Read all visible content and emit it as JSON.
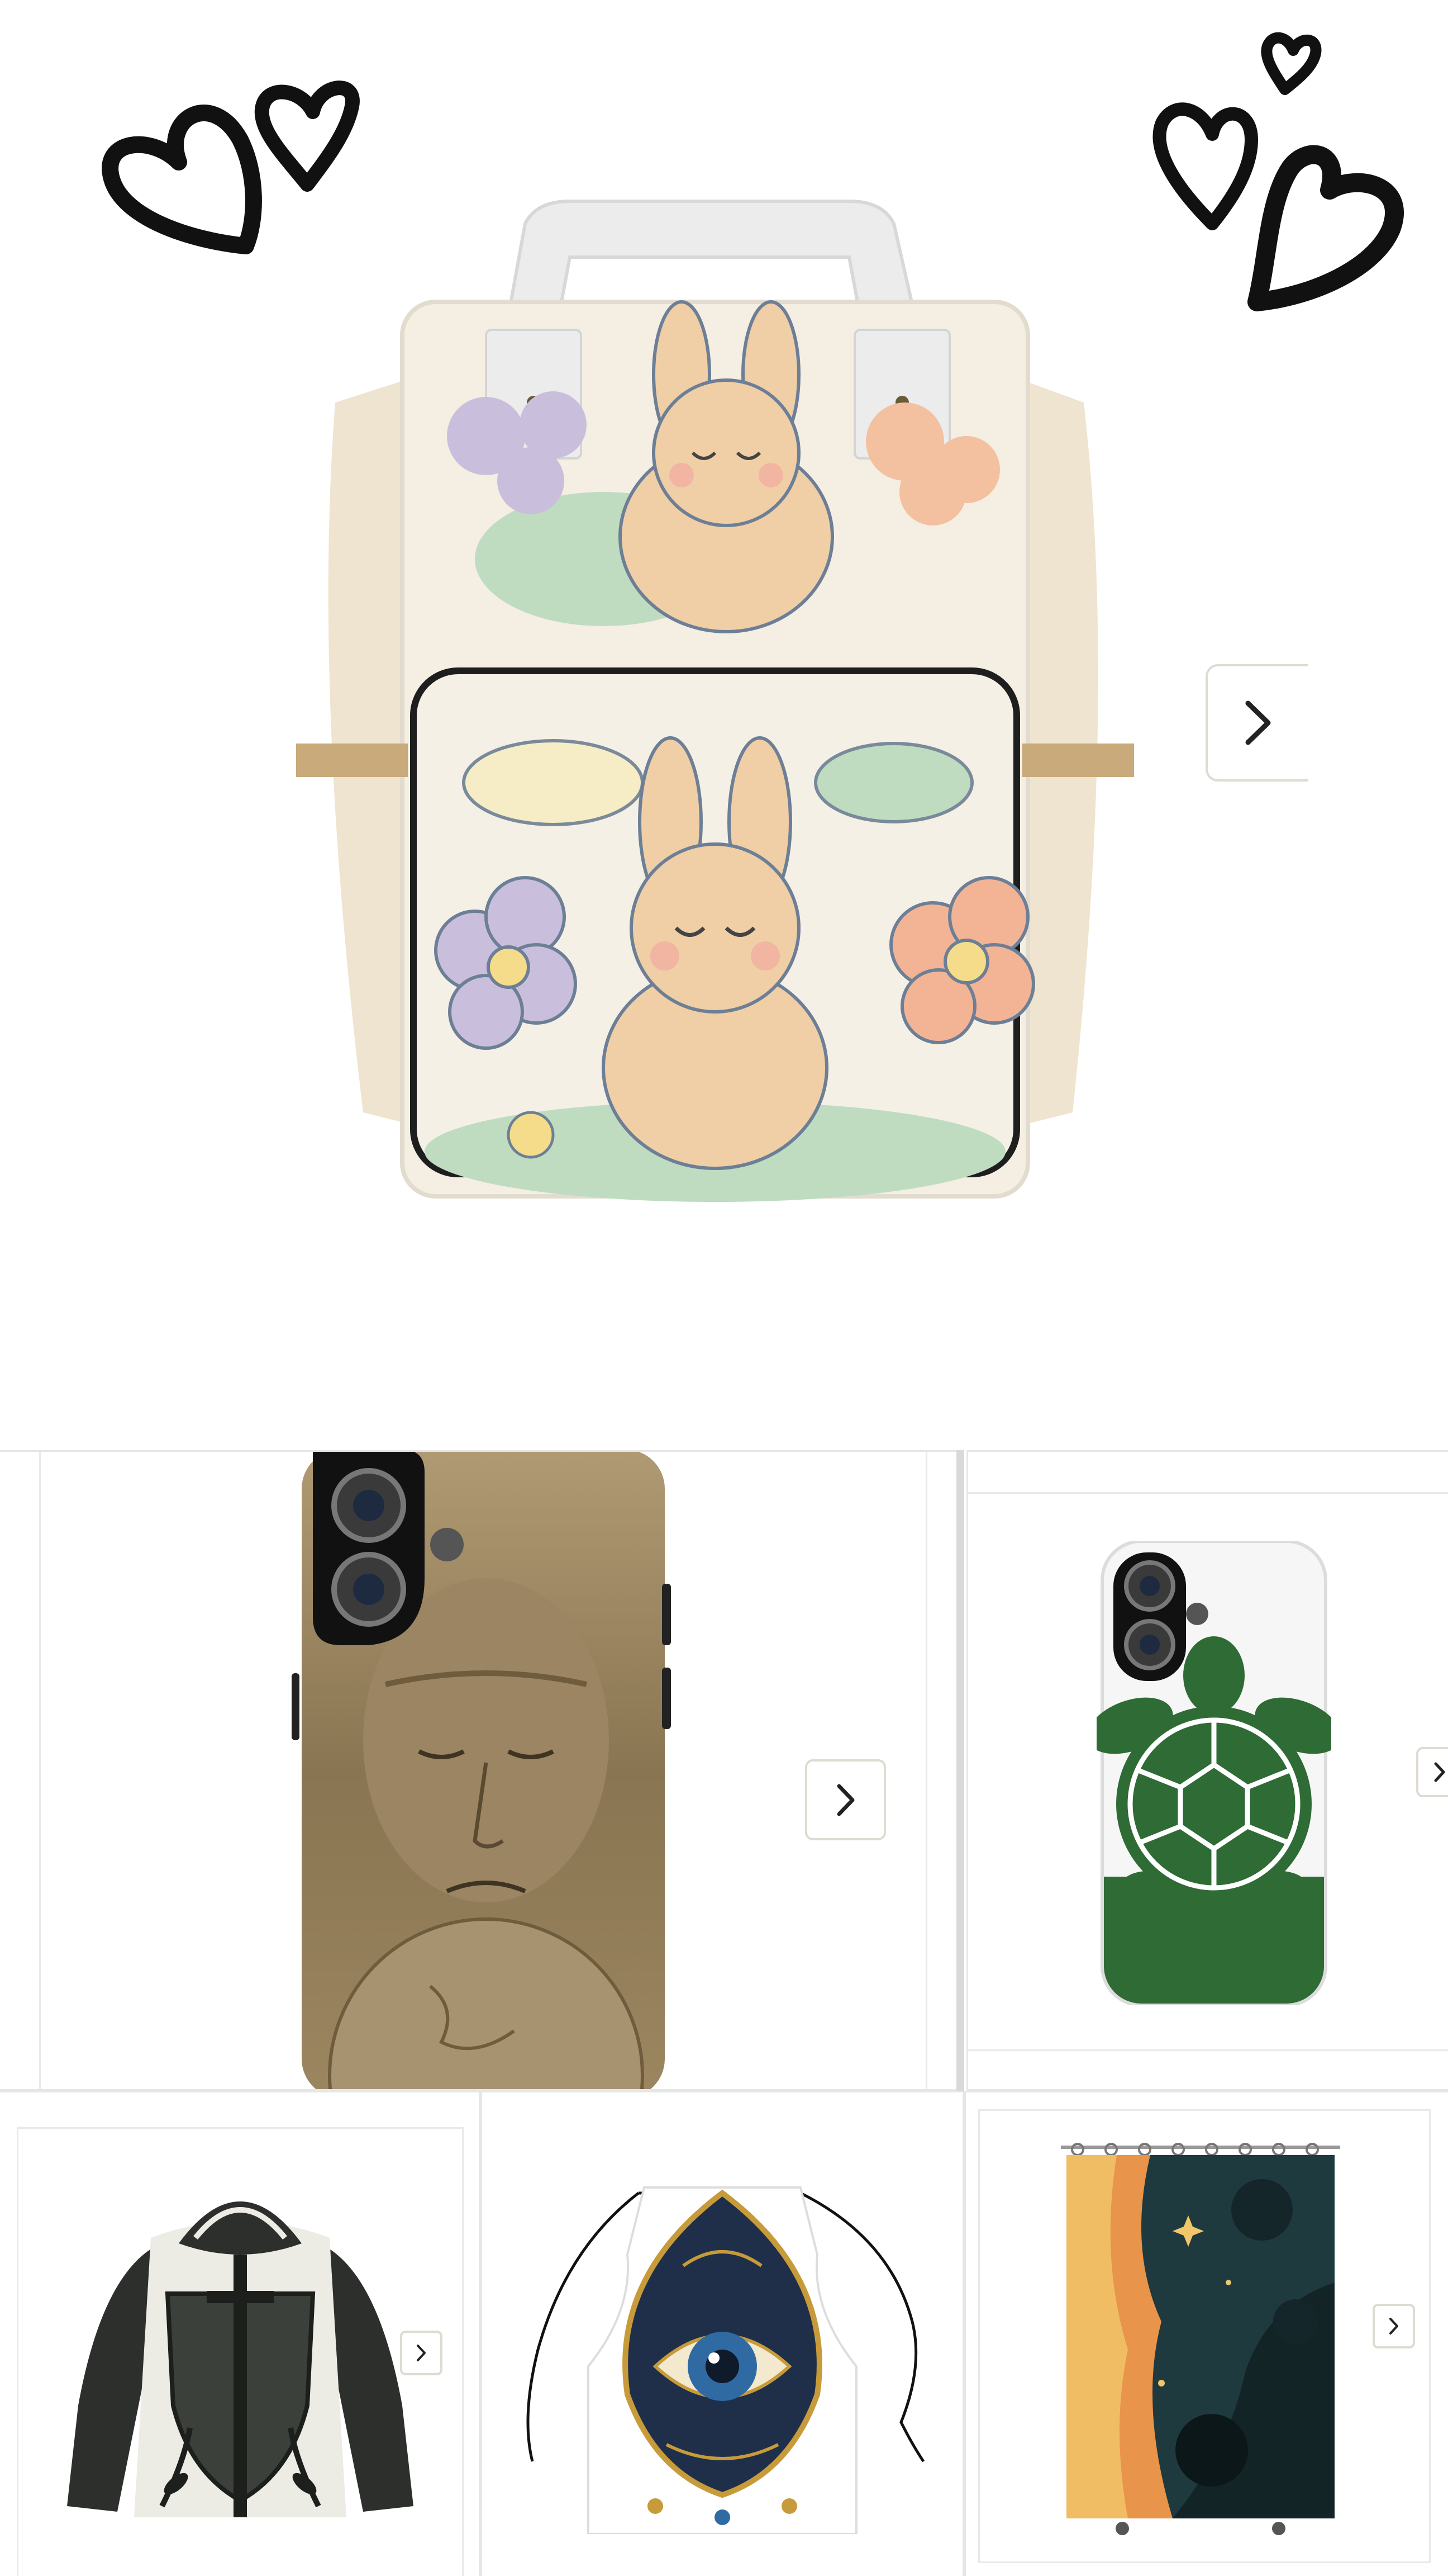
{
  "listings": {
    "hero": {
      "product_icon": "bunny-backpack-image",
      "next_icon": "chevron-right-icon"
    },
    "tiles": [
      {
        "product_icon": "elder-portrait-phone-case-image",
        "next_icon": "chevron-right-icon"
      },
      {
        "product_icon": "turtle-phone-case-image",
        "next_icon": "chevron-right-icon"
      },
      {
        "product_icon": "shield-sword-hoodie-image",
        "next_icon": "chevron-right-icon"
      },
      {
        "product_icon": "evil-eye-apron-image"
      },
      {
        "product_icon": "cosmic-shower-curtain-image",
        "next_icon": "chevron-right-icon"
      }
    ]
  },
  "colors": {
    "background": "#ffffff",
    "tile_border": "#e6e6e6",
    "button_border": "#dedbd2",
    "chevron": "#222222",
    "backpack_cream": "#f3ede1",
    "bunny": "#f0cfa6",
    "turtle_green": "#2e6b35",
    "sepia": "#8a7552"
  }
}
